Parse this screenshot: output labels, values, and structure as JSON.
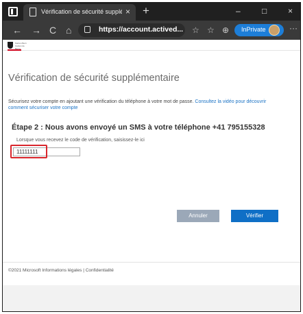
{
  "browser": {
    "tab_title": "Vérification de sécurité supplém",
    "tab_close": "×",
    "new_tab": "+",
    "window_controls": [
      "–",
      "□",
      "×"
    ],
    "nav": {
      "back": "←",
      "forward": "→",
      "refresh": "C",
      "home": "⌂"
    },
    "url": "https://account.actived...",
    "toolbar_icons": [
      "☆",
      "☆",
      "⊕"
    ],
    "inprivate_label": "InPrivate",
    "more": "···"
  },
  "header": {
    "org_name": "Kanton Bern Canton de Berne",
    "accent_color": "#d0021b"
  },
  "main": {
    "title": "Vérification de sécurité supplémentaire",
    "intro_text": "Sécurisez votre compte en ajoutant une vérification du téléphone à votre mot de passe.",
    "intro_link": "Consultez la vidéo pour découvrir comment sécuriser votre compte",
    "step_title": "Étape 2 : Nous avons envoyé un SMS à votre téléphone +41 795155328",
    "hint": "Lorsque vous recevez le code de vérification, saisissez-le ici",
    "code_value": "11111111",
    "cancel_label": "Annuler",
    "verify_label": "Vérifier"
  },
  "footer": {
    "text": "©2021 Microsoft   Informations légales   |   Confidentialité"
  },
  "colors": {
    "primary_button": "#0f6fc6",
    "disabled_button": "#9ba8b8",
    "highlight": "#d9252b",
    "browser_chrome": "#202020",
    "inprivate": "#1d7ed8"
  }
}
